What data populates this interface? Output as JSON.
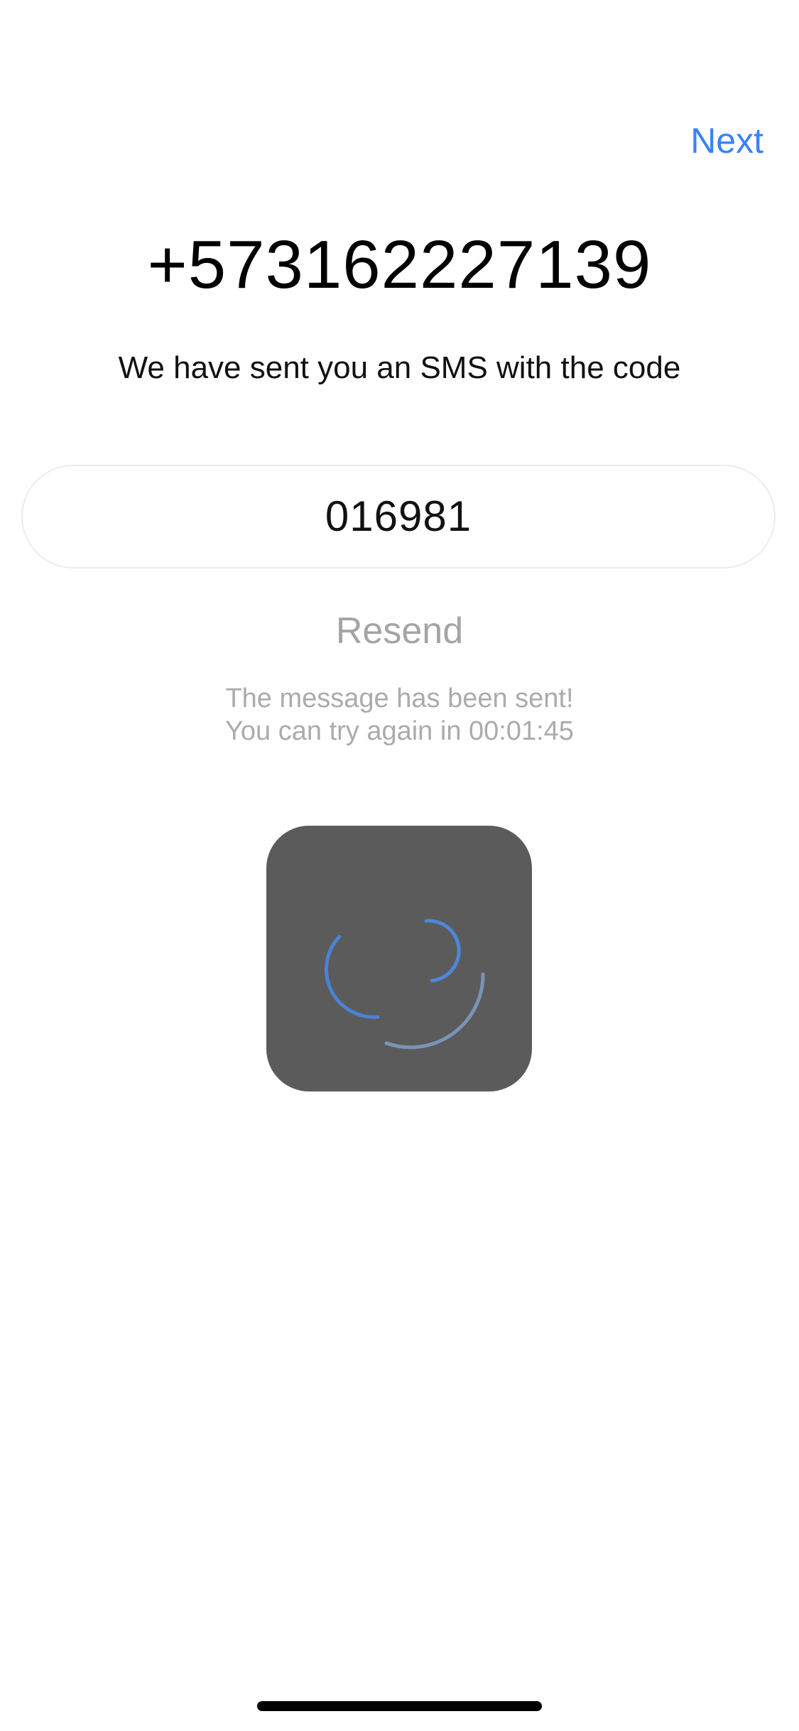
{
  "nav": {
    "next_label": "Next"
  },
  "verification": {
    "phone_number": "+573162227139",
    "subtitle": "We have sent you an SMS with the code",
    "code_value": "016981",
    "resend_label": "Resend",
    "message_line1": "The message has been sent!",
    "message_line2": "You can try again in 00:01:45"
  },
  "loading": {
    "icon": "spinner-icon"
  },
  "colors": {
    "accent": "#3a82f7",
    "muted_text": "#a4a4a4",
    "hud_background": "#5b5b5b"
  }
}
